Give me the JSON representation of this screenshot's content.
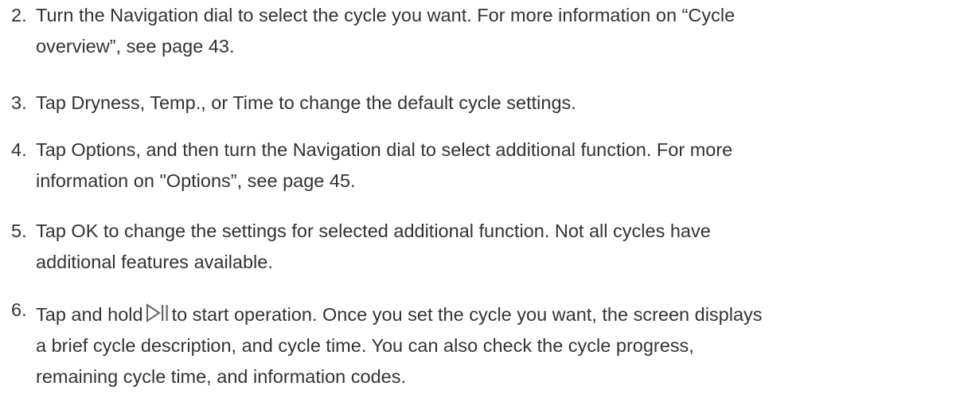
{
  "steps": [
    {
      "number": "2.",
      "lines": [
        "Turn the Navigation dial to select the cycle you want. For more information on “Cycle",
        "overview”, see page 43."
      ]
    },
    {
      "number": "3.",
      "lines": [
        "Tap Dryness, Temp., or Time to change the default cycle settings."
      ]
    },
    {
      "number": "4.",
      "lines": [
        "Tap Options, and then turn the Navigation dial to select additional function. For more",
        "information on \"Options”, see page 45."
      ]
    },
    {
      "number": "5.",
      "lines": [
        "Tap OK to change the settings for selected additional function. Not all cycles have",
        "additional features available."
      ]
    },
    {
      "number": "6.",
      "line1_before_icon": "Tap and hold",
      "line1_after_icon": "to start operation. Once you set the cycle you want, the screen displays",
      "icon": "play-pause-icon",
      "lines_rest": [
        "a brief cycle description, and cycle time. You can also check the cycle progress,",
        "remaining cycle time, and information codes."
      ]
    }
  ]
}
